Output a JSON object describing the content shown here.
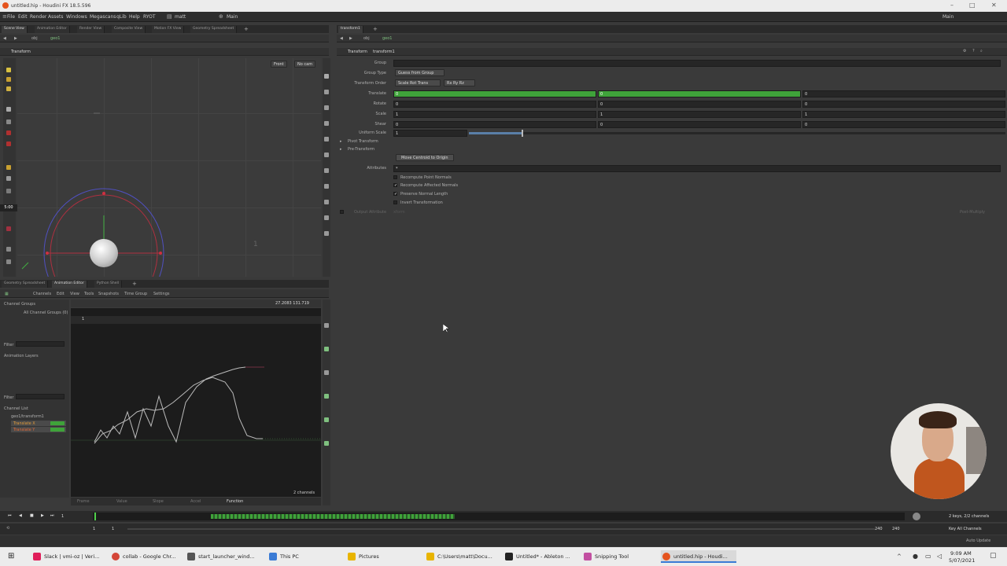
{
  "window": {
    "title": "untitled.hip - Houdini FX 18.5.596"
  },
  "menubar": {
    "items": [
      "File",
      "Edit",
      "Render",
      "Assets",
      "Windows",
      "Megascans",
      "qLib",
      "Help",
      "RYOT"
    ],
    "user_desk": "matt",
    "desktop": "Main",
    "right_label": "Main"
  },
  "viewer_tabs": [
    "Scene View",
    "Animation Editor",
    "Render View",
    "Composite View",
    "Motion FX View",
    "Geometry Spreadsheet"
  ],
  "viewer": {
    "path_obj": "obj",
    "path_geo": "geo1",
    "pane_title": "Transform",
    "view_menu": "Front",
    "cam_menu": "No cam",
    "frame_num": "1",
    "time_badge": "5:00"
  },
  "params_tabs": [
    "transform1"
  ],
  "params": {
    "path_obj": "obj",
    "path_geo": "geo1",
    "node_type": "Transform",
    "node_name": "transform1",
    "group_label": "Group",
    "group_type_label": "Group Type",
    "group_type_value": "Guess from Group",
    "xform_order_label": "Transform Order",
    "xform_order_value": "Scale Rot Trans",
    "rot_order_value": "Rx Ry Rz",
    "translate_label": "Translate",
    "translate": [
      "0",
      "0",
      "0"
    ],
    "rotate_label": "Rotate",
    "rotate": [
      "0",
      "0",
      "0"
    ],
    "scale_label": "Scale",
    "scale": [
      "1",
      "1",
      "1"
    ],
    "shear_label": "Shear",
    "shear": [
      "0",
      "0",
      "0"
    ],
    "uniform_scale_label": "Uniform Scale",
    "uniform_scale": "1",
    "pivot_label": "Pivot Transform",
    "pretransform_label": "Pre-Transform",
    "centroid_button": "Move Centroid to Origin",
    "attributes_label": "Attributes",
    "attributes_value": "*",
    "recompute_point_normals": "Recompute Point Normals",
    "recompute_affected_normals": "Recompute Affected Normals",
    "preserve_normal_length": "Preserve Normal Length",
    "invert_transformation": "Invert Transformation",
    "output_attribute_label": "Output Attribute",
    "output_attribute_value": "xform",
    "post_multiply": "Post-Multiply"
  },
  "lower_tabs": [
    "Geometry Spreadsheet",
    "Animation Editor",
    "Python Shell"
  ],
  "anim_editor": {
    "menu": [
      "Channels",
      "Edit",
      "View",
      "Tools",
      "Snapshots",
      "Time Group",
      "Settings"
    ],
    "channel_groups_label": "Channel Groups",
    "all_channel_groups": "All Channel Groups (0)",
    "filter_label": "Filter",
    "animation_layers_label": "Animation Layers",
    "channel_list_label": "Channel List",
    "node_path": "geo1/transform1",
    "channel_1": "Translate X",
    "channel_2": "Translate Y",
    "readout": "27.2083  131.719",
    "frame_label": "1",
    "channels_count": "2 channels",
    "footer_frame": "Frame",
    "footer_value": "Value",
    "footer_slope": "Slope",
    "footer_accel": "Accel",
    "footer_function": "Function"
  },
  "timeline": {
    "frame": "1",
    "start": "1",
    "start2": "1",
    "end": "240",
    "end2": "240",
    "keys_info": "2 keys, 2/2 channels",
    "key_all": "Key All Channels",
    "auto_update": "Auto Update"
  },
  "taskbar": {
    "apps": [
      {
        "label": "Slack | vmi-oz | Veri...",
        "color": "#e01e5a"
      },
      {
        "label": "collab - Google Chr...",
        "color": "#d44638"
      },
      {
        "label": "start_launcher_wind...",
        "color": "#555555"
      },
      {
        "label": "This PC",
        "color": "#3a7bd5"
      },
      {
        "label": "Pictures",
        "color": "#e8b400"
      },
      {
        "label": "C:\\Users\\matt\\Docu...",
        "color": "#e8b400"
      },
      {
        "label": "Untitled* - Ableton ...",
        "color": "#222222"
      },
      {
        "label": "Snipping Tool",
        "color": "#c24fa1"
      },
      {
        "label": "untitled.hip - Houdi...",
        "color": "#e5541e"
      }
    ],
    "time": "9:09 AM",
    "date": "5/07/2021"
  },
  "colors": {
    "green": "#3fa33a",
    "accent": "#e5541e",
    "bg": "#3a3a3a"
  }
}
